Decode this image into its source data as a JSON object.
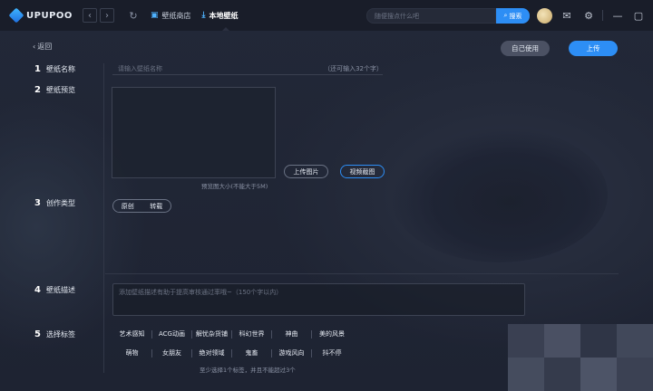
{
  "app": {
    "logo_text": "UPUPOO"
  },
  "nav": {
    "back_arrow": "‹",
    "forward_arrow": "›",
    "tabs": [
      {
        "label": "壁纸商店",
        "icon": "store-icon"
      },
      {
        "label": "本地壁纸",
        "icon": "download-icon"
      }
    ]
  },
  "search": {
    "placeholder": "随便搜点什么吧",
    "button_label": "搜索",
    "icon": "search-icon"
  },
  "window": {
    "icons": [
      "mail-icon",
      "gear-icon",
      "minimize-icon",
      "maximize-icon"
    ]
  },
  "page": {
    "back_label": "返回",
    "self_use_label": "自己使用",
    "upload_label": "上传"
  },
  "form": {
    "name": {
      "num": "1",
      "label": "壁纸名称",
      "placeholder": "请输入壁纸名称",
      "hint": "（还可输入32个字）"
    },
    "preview": {
      "num": "2",
      "label": "壁纸预览",
      "size_hint": "预览图大小(不能大于5M)",
      "upload_image_label": "上传图片",
      "video_capture_label": "视频截图"
    },
    "type": {
      "num": "3",
      "label": "创作类型",
      "options": [
        "原创",
        "转载"
      ]
    },
    "description": {
      "num": "4",
      "label": "壁纸描述",
      "placeholder": "添加壁纸描述有助于提高审核通过率哦~（150个字以内）"
    },
    "tags": {
      "num": "5",
      "label": "选择标签",
      "row1": [
        "艺术感知",
        "ACG动画",
        "解忧杂货铺",
        "科幻世界",
        "神曲",
        "美的风景"
      ],
      "row2": [
        "萌物",
        "女朋友",
        "绝对领域",
        "鬼畜",
        "游戏风向",
        "抖不停"
      ],
      "hint": "至少选择1个标签，并且不能超过3个"
    }
  },
  "colors": {
    "accent": "#2d8ef5",
    "topbar": "#191d29",
    "background": "#1f2433"
  }
}
